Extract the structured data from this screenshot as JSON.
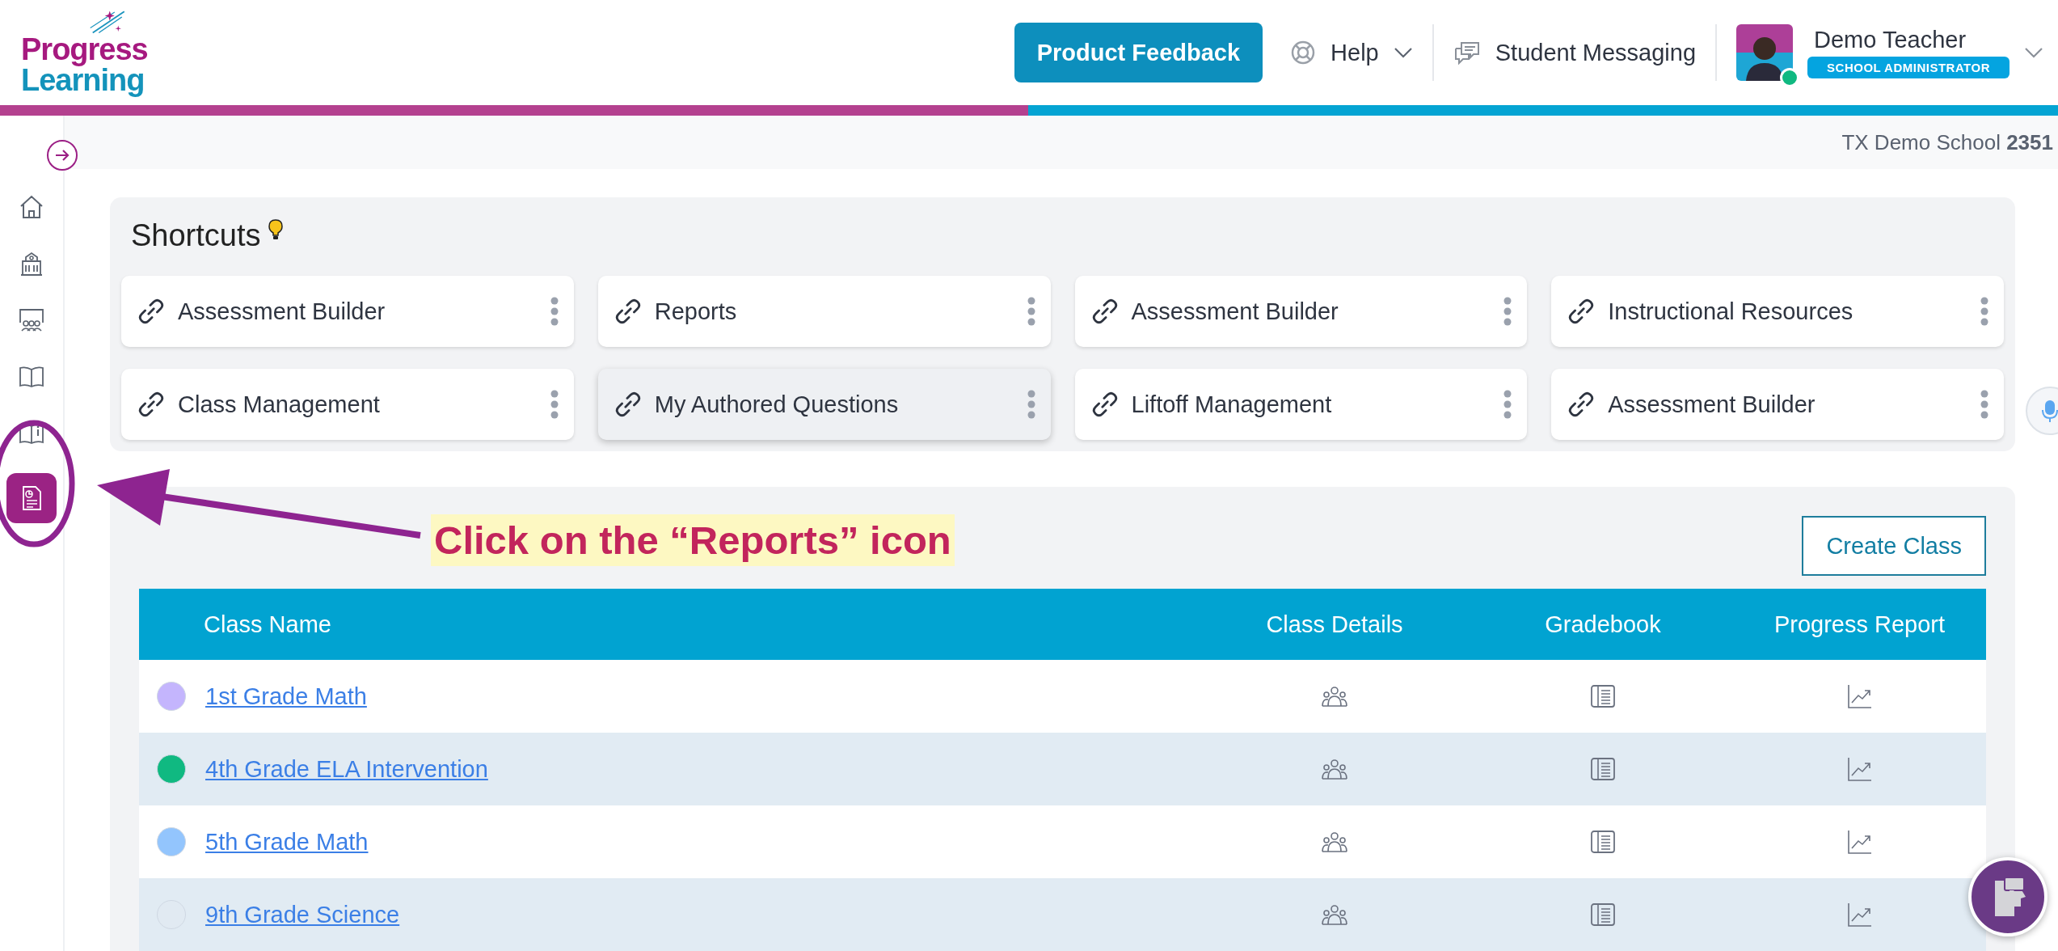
{
  "logo": {
    "line1": "Progress",
    "line2": "Learning"
  },
  "header": {
    "feedback_button": "Product Feedback",
    "help": "Help",
    "messaging": "Student Messaging",
    "user": {
      "name": "Demo Teacher",
      "role": "SCHOOL ADMINISTRATOR",
      "online": true
    }
  },
  "school": {
    "name": "TX Demo School",
    "code": "2351"
  },
  "sidebar": {
    "items": [
      {
        "kind": "home",
        "selected": false
      },
      {
        "kind": "school",
        "selected": false
      },
      {
        "kind": "classroom",
        "selected": false
      },
      {
        "kind": "book",
        "selected": false
      },
      {
        "kind": "book-info",
        "selected": false
      },
      {
        "kind": "reports",
        "selected": true
      }
    ]
  },
  "shortcuts": {
    "title": "Shortcuts",
    "items": [
      {
        "label": "Assessment Builder",
        "hovered": false
      },
      {
        "label": "Reports",
        "hovered": false
      },
      {
        "label": "Assessment Builder",
        "hovered": false
      },
      {
        "label": "Instructional Resources",
        "hovered": false
      },
      {
        "label": "Class Management",
        "hovered": false
      },
      {
        "label": "My Authored Questions",
        "hovered": true
      },
      {
        "label": "Liftoff Management",
        "hovered": false
      },
      {
        "label": "Assessment Builder",
        "hovered": false
      }
    ]
  },
  "classes": {
    "create_button": "Create Class",
    "columns": [
      {
        "label": "Class Name",
        "kind": "name"
      },
      {
        "label": "Class Details",
        "kind": "details"
      },
      {
        "label": "Gradebook",
        "kind": "gradebook"
      },
      {
        "label": "Progress Report",
        "kind": "progress"
      }
    ],
    "rows": [
      {
        "name": "1st Grade Math",
        "color": "#c4b5fd"
      },
      {
        "name": "4th Grade ELA Intervention",
        "color": "#10b981"
      },
      {
        "name": "5th Grade Math",
        "color": "#93c5fd"
      },
      {
        "name": "9th Grade Science",
        "color": "#e1eaf2"
      }
    ]
  },
  "annotation": {
    "text": "Click on the “Reports” icon"
  }
}
